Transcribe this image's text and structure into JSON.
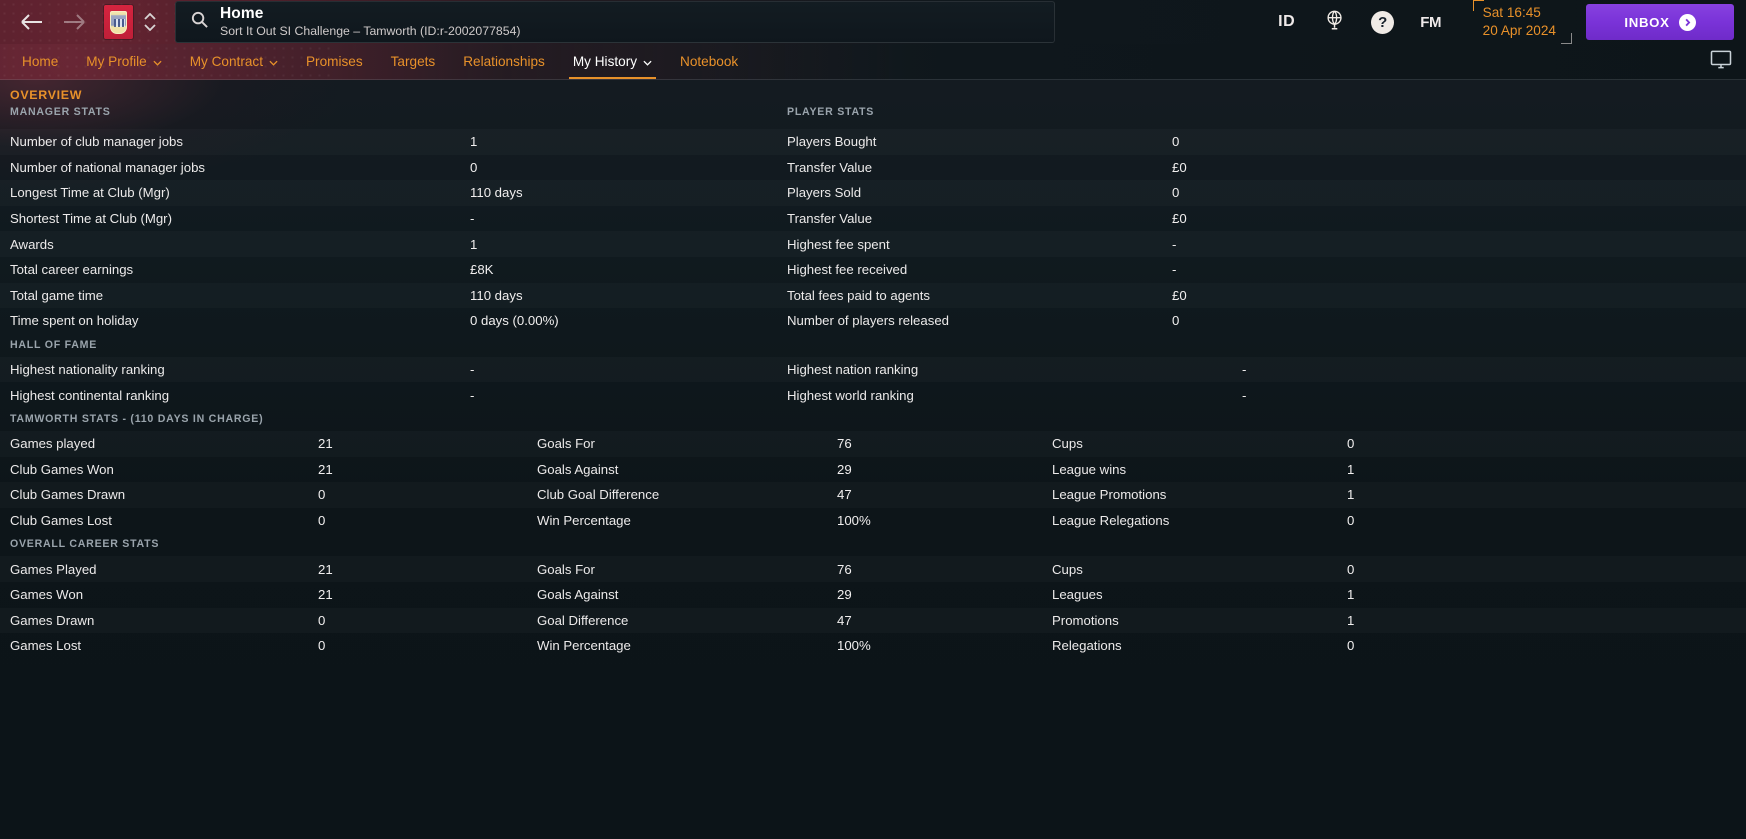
{
  "titlebar": {
    "back_icon": "arrow-left-icon",
    "forward_icon": "arrow-right-icon",
    "badge_name": "tamworth-club-badge",
    "search": {
      "title": "Home",
      "subtitle": "Sort It Out SI Challenge – Tamworth (ID:r-2002077854)",
      "placeholder": "Search"
    },
    "id_label": "ID",
    "globe_icon": "globe-icon",
    "help_label": "?",
    "fm_label": "FM",
    "clock_time": "Sat 16:45",
    "clock_date": "20 Apr 2024",
    "inbox_label": "INBOX"
  },
  "nav": {
    "items": [
      {
        "label": "Home",
        "dropdown": false,
        "active": false
      },
      {
        "label": "My Profile",
        "dropdown": true,
        "active": false
      },
      {
        "label": "My Contract",
        "dropdown": true,
        "active": false
      },
      {
        "label": "Promises",
        "dropdown": false,
        "active": false
      },
      {
        "label": "Targets",
        "dropdown": false,
        "active": false
      },
      {
        "label": "Relationships",
        "dropdown": false,
        "active": false
      },
      {
        "label": "My History",
        "dropdown": true,
        "active": true
      },
      {
        "label": "Notebook",
        "dropdown": false,
        "active": false
      }
    ],
    "monitor_icon": "monitor-icon"
  },
  "page": {
    "overview_title": "OVERVIEW",
    "colors": {
      "accent": "#e8912a",
      "inbox": "#7a33d8",
      "badge_red": "#c8213c",
      "text": "#eceaea",
      "muted": "#9aa4ac"
    }
  },
  "sections": {
    "manager_player": {
      "header_left": "MANAGER STATS",
      "header_right": "PLAYER STATS",
      "rows": [
        {
          "label_a": "Number of club manager jobs",
          "value_a": "1",
          "label_b": "Players Bought",
          "value_b": "0"
        },
        {
          "label_a": "Number of national manager jobs",
          "value_a": "0",
          "label_b": "Transfer Value",
          "value_b": "£0"
        },
        {
          "label_a": "Longest Time at Club (Mgr)",
          "value_a": "110 days",
          "label_b": "Players Sold",
          "value_b": "0"
        },
        {
          "label_a": "Shortest Time at Club (Mgr)",
          "value_a": "-",
          "label_b": "Transfer Value",
          "value_b": "£0"
        },
        {
          "label_a": "Awards",
          "value_a": "1",
          "label_b": "Highest fee spent",
          "value_b": "-"
        },
        {
          "label_a": "Total career earnings",
          "value_a": "£8K",
          "label_b": "Highest fee received",
          "value_b": "-"
        },
        {
          "label_a": "Total game time",
          "value_a": "110 days",
          "label_b": "Total fees paid to agents",
          "value_b": "£0"
        },
        {
          "label_a": "Time spent on holiday",
          "value_a": "0 days (0.00%)",
          "label_b": "Number of players released",
          "value_b": "0"
        }
      ]
    },
    "hall_of_fame": {
      "header": "HALL OF FAME",
      "rows": [
        {
          "label_a": "Highest nationality ranking",
          "value_a": "-",
          "label_b": "Highest nation ranking",
          "value_b": "-"
        },
        {
          "label_a": "Highest continental ranking",
          "value_a": "-",
          "label_b": "Highest world ranking",
          "value_b": "-"
        }
      ]
    },
    "tamworth_stats": {
      "header": "TAMWORTH STATS - (110 DAYS IN CHARGE)",
      "rows": [
        {
          "label_a": "Games played",
          "value_a": "21",
          "label_b": "Goals For",
          "value_b": "76",
          "label_c": "Cups",
          "value_c": "0"
        },
        {
          "label_a": "Club Games Won",
          "value_a": "21",
          "label_b": "Goals Against",
          "value_b": "29",
          "label_c": "League wins",
          "value_c": "1"
        },
        {
          "label_a": "Club Games Drawn",
          "value_a": "0",
          "label_b": "Club Goal Difference",
          "value_b": "47",
          "label_c": "League Promotions",
          "value_c": "1"
        },
        {
          "label_a": "Club Games Lost",
          "value_a": "0",
          "label_b": "Win Percentage",
          "value_b": "100%",
          "label_c": "League Relegations",
          "value_c": "0"
        }
      ]
    },
    "overall_career": {
      "header": "OVERALL CAREER STATS",
      "rows": [
        {
          "label_a": "Games Played",
          "value_a": "21",
          "label_b": "Goals For",
          "value_b": "76",
          "label_c": "Cups",
          "value_c": "0"
        },
        {
          "label_a": "Games Won",
          "value_a": "21",
          "label_b": "Goals Against",
          "value_b": "29",
          "label_c": "Leagues",
          "value_c": "1"
        },
        {
          "label_a": "Games Drawn",
          "value_a": "0",
          "label_b": "Goal Difference",
          "value_b": "47",
          "label_c": "Promotions",
          "value_c": "1"
        },
        {
          "label_a": "Games Lost",
          "value_a": "0",
          "label_b": "Win Percentage",
          "value_b": "100%",
          "label_c": "Relegations",
          "value_c": "0"
        }
      ]
    }
  }
}
